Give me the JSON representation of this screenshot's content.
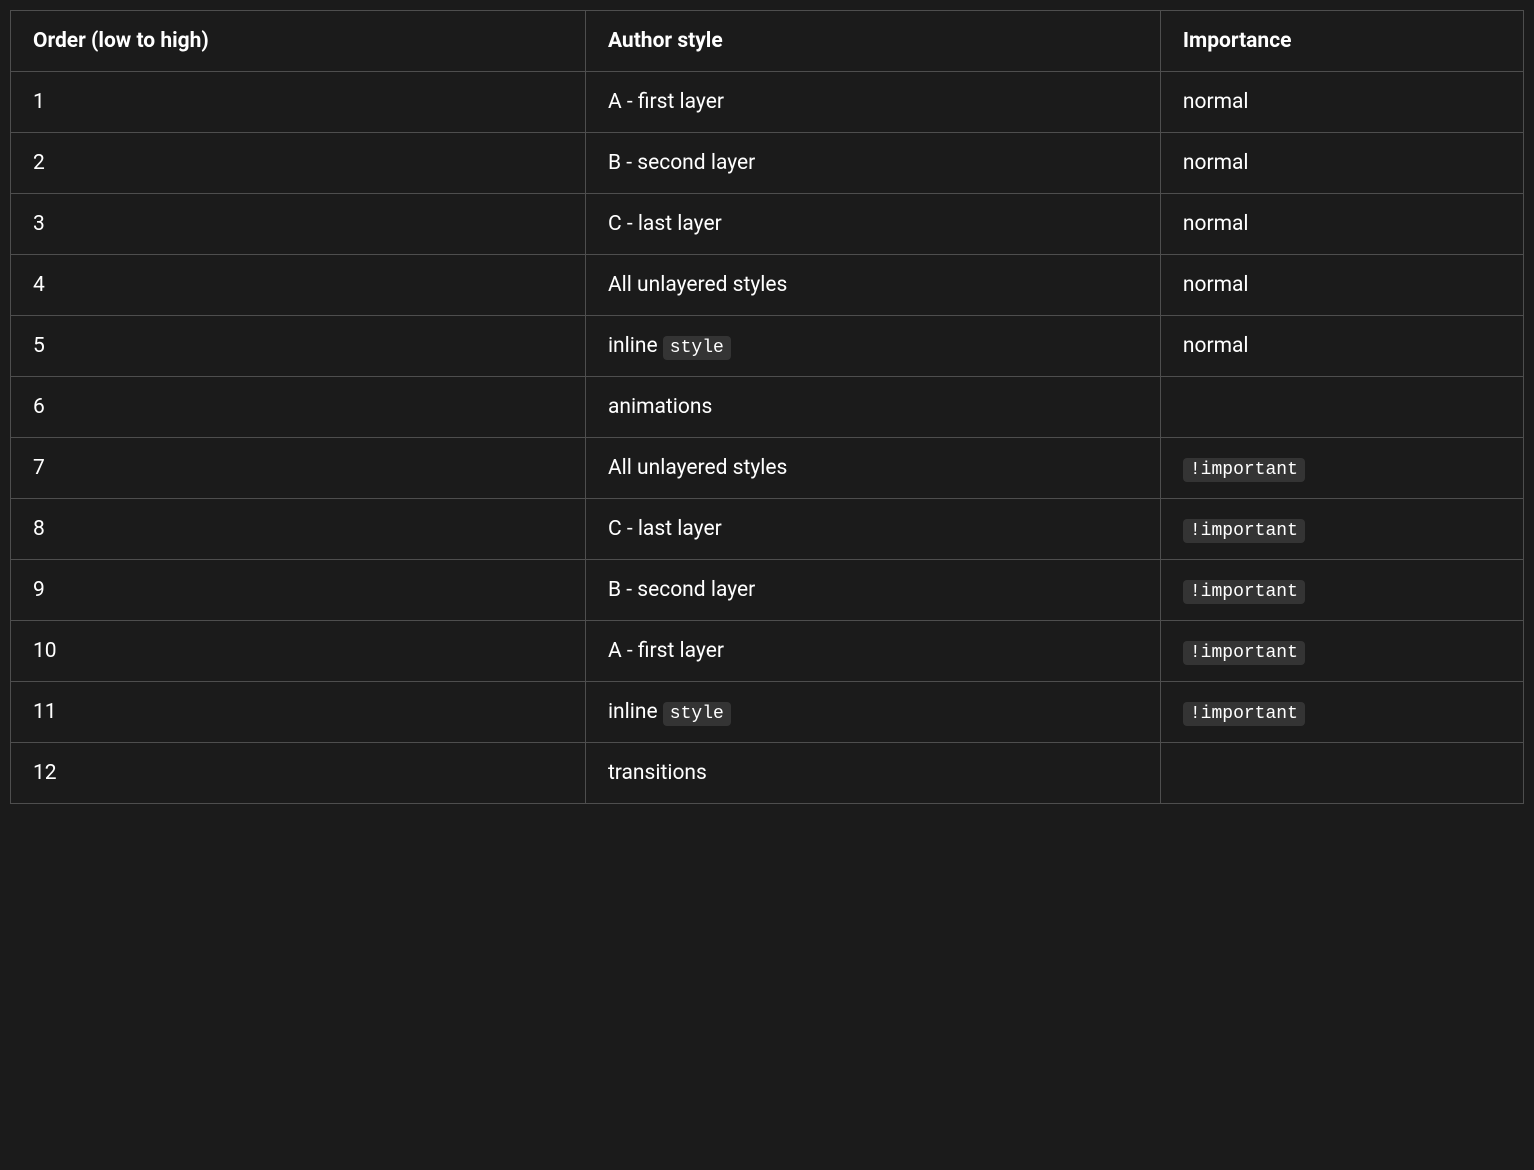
{
  "table": {
    "headers": {
      "order": "Order (low to high)",
      "author_style": "Author style",
      "importance": "Importance"
    },
    "rows": [
      {
        "order": "1",
        "author_style": [
          {
            "type": "text",
            "value": "A - first layer"
          }
        ],
        "importance": [
          {
            "type": "text",
            "value": "normal"
          }
        ]
      },
      {
        "order": "2",
        "author_style": [
          {
            "type": "text",
            "value": "B - second layer"
          }
        ],
        "importance": [
          {
            "type": "text",
            "value": "normal"
          }
        ]
      },
      {
        "order": "3",
        "author_style": [
          {
            "type": "text",
            "value": "C - last layer"
          }
        ],
        "importance": [
          {
            "type": "text",
            "value": "normal"
          }
        ]
      },
      {
        "order": "4",
        "author_style": [
          {
            "type": "text",
            "value": "All unlayered styles"
          }
        ],
        "importance": [
          {
            "type": "text",
            "value": "normal"
          }
        ]
      },
      {
        "order": "5",
        "author_style": [
          {
            "type": "text",
            "value": "inline "
          },
          {
            "type": "code",
            "value": "style"
          }
        ],
        "importance": [
          {
            "type": "text",
            "value": "normal"
          }
        ]
      },
      {
        "order": "6",
        "author_style": [
          {
            "type": "text",
            "value": "animations"
          }
        ],
        "importance": []
      },
      {
        "order": "7",
        "author_style": [
          {
            "type": "text",
            "value": "All unlayered styles"
          }
        ],
        "importance": [
          {
            "type": "code",
            "value": "!important"
          }
        ]
      },
      {
        "order": "8",
        "author_style": [
          {
            "type": "text",
            "value": "C - last layer"
          }
        ],
        "importance": [
          {
            "type": "code",
            "value": "!important"
          }
        ]
      },
      {
        "order": "9",
        "author_style": [
          {
            "type": "text",
            "value": "B - second layer"
          }
        ],
        "importance": [
          {
            "type": "code",
            "value": "!important"
          }
        ]
      },
      {
        "order": "10",
        "author_style": [
          {
            "type": "text",
            "value": "A - first layer"
          }
        ],
        "importance": [
          {
            "type": "code",
            "value": "!important"
          }
        ]
      },
      {
        "order": "11",
        "author_style": [
          {
            "type": "text",
            "value": "inline "
          },
          {
            "type": "code",
            "value": "style"
          }
        ],
        "importance": [
          {
            "type": "code",
            "value": "!important"
          }
        ]
      },
      {
        "order": "12",
        "author_style": [
          {
            "type": "text",
            "value": "transitions"
          }
        ],
        "importance": []
      }
    ]
  }
}
